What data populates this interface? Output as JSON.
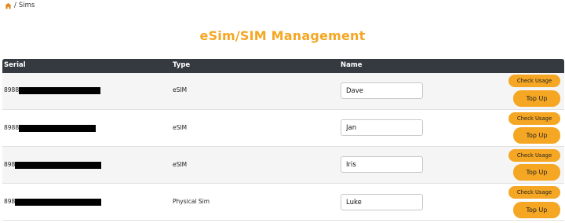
{
  "breadcrumb": {
    "separator": "/",
    "current": "Sims"
  },
  "title": "eSim/SIM Management",
  "table": {
    "headers": {
      "serial": "Serial",
      "type": "Type",
      "name": "Name"
    },
    "rows": [
      {
        "serial_prefix": "8988",
        "type": "eSIM",
        "name": "Dave",
        "check_label": "Check Usage",
        "topup_label": "Top Up"
      },
      {
        "serial_prefix": "8988",
        "type": "eSIM",
        "name": "Jan",
        "check_label": "Check Usage",
        "topup_label": "Top Up"
      },
      {
        "serial_prefix": "898",
        "type": "eSIM",
        "name": "Iris",
        "check_label": "Check Usage",
        "topup_label": "Top Up"
      },
      {
        "serial_prefix": "898",
        "type": "Physical Sim",
        "name": "Luke",
        "check_label": "Check Usage",
        "topup_label": "Top Up"
      }
    ]
  },
  "colors": {
    "accent": "#f5a623",
    "header_bg": "#343a40"
  }
}
